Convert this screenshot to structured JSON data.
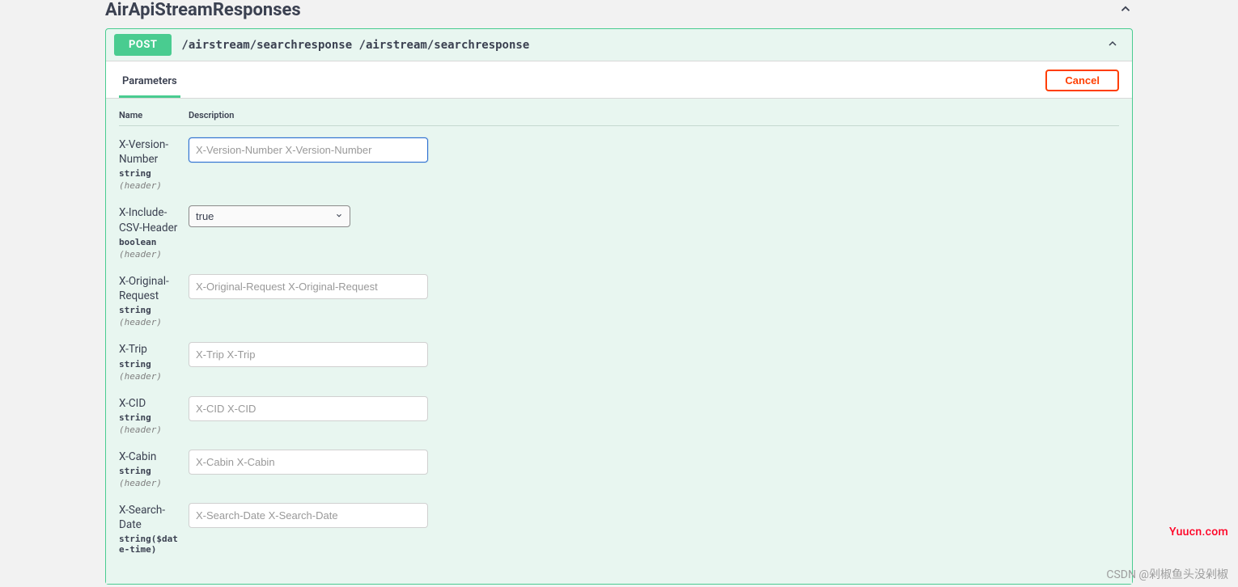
{
  "tag": {
    "title": "AirApiStreamResponses"
  },
  "operation": {
    "method": "POST",
    "path": "/airstream/searchresponse /airstream/searchresponse"
  },
  "tabs": {
    "parameters": "Parameters"
  },
  "buttons": {
    "cancel": "Cancel"
  },
  "table": {
    "name_header": "Name",
    "desc_header": "Description"
  },
  "params": [
    {
      "name": "X-Version-Number",
      "type": "string",
      "loc": "(header)",
      "control": "text",
      "placeholder": "X-Version-Number X-Version-Number",
      "focused": true
    },
    {
      "name": "X-Include-CSV-Header",
      "type": "boolean",
      "loc": "(header)",
      "control": "select",
      "value": "true"
    },
    {
      "name": "X-Original-Request",
      "type": "string",
      "loc": "(header)",
      "control": "text",
      "placeholder": "X-Original-Request X-Original-Request"
    },
    {
      "name": "X-Trip",
      "type": "string",
      "loc": "(header)",
      "control": "text",
      "placeholder": "X-Trip X-Trip"
    },
    {
      "name": "X-CID",
      "type": "string",
      "loc": "(header)",
      "control": "text",
      "placeholder": "X-CID X-CID"
    },
    {
      "name": "X-Cabin",
      "type": "string",
      "loc": "(header)",
      "control": "text",
      "placeholder": "X-Cabin X-Cabin"
    },
    {
      "name": "X-Search-Date",
      "type": "string($date-time)",
      "loc": "",
      "control": "text",
      "placeholder": "X-Search-Date X-Search-Date"
    }
  ],
  "watermark": {
    "red": "Yuucn.com",
    "grey": "CSDN @剁椒鱼头没剁椒"
  }
}
